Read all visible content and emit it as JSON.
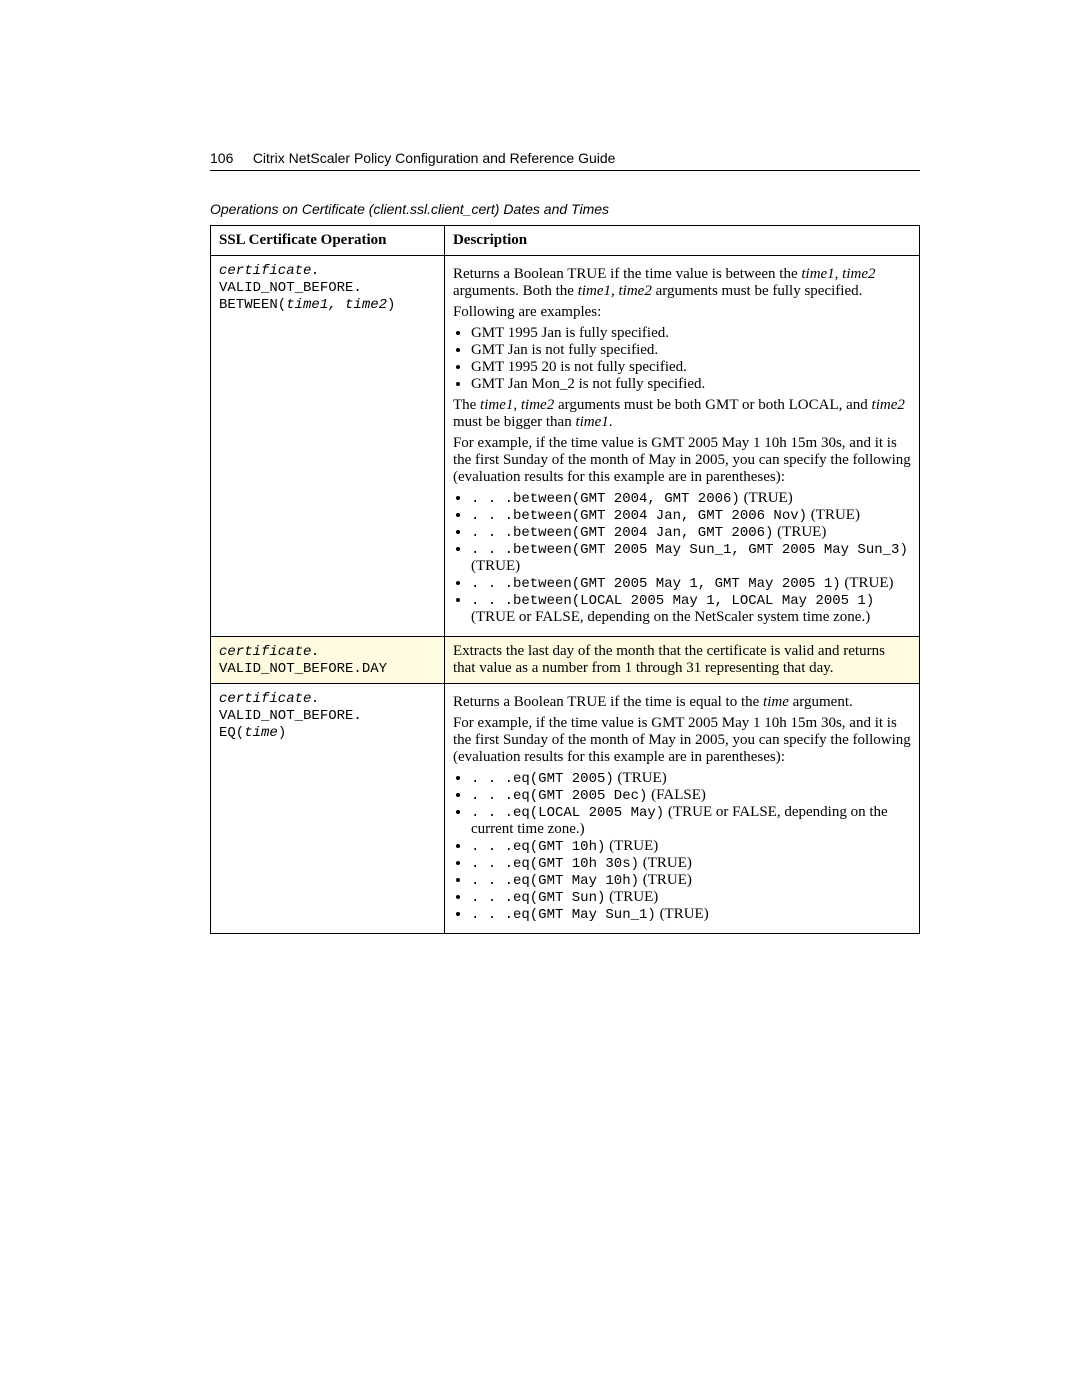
{
  "header": {
    "page_number": "106",
    "title": "Citrix NetScaler Policy Configuration and Reference Guide"
  },
  "caption": "Operations on Certificate (client.ssl.client_cert) Dates and Times",
  "table": {
    "headers": {
      "col1": "SSL Certificate Operation",
      "col2": "Description"
    },
    "rows": [
      {
        "op_prefix": "certificate.",
        "op_line2": "VALID_NOT_BEFORE.",
        "op_line3_a": "BETWEEN(",
        "op_line3_b": "time1, time2",
        "op_line3_c": ")",
        "desc": {
          "p1_a": "Returns a Boolean TRUE if the time value is between the ",
          "p1_i1": "time1, time2",
          "p1_b": " arguments. Both the ",
          "p1_i2": "time1, time2",
          "p1_c": " arguments must be fully specified.",
          "p2": "Following are examples:",
          "list1": [
            "GMT 1995 Jan is fully specified.",
            "GMT Jan is not fully specified.",
            "GMT 1995 20 is not fully specified.",
            "GMT Jan Mon_2 is not fully specified."
          ],
          "p3_a": "The ",
          "p3_i1": "time1, time2",
          "p3_b": " arguments must be both GMT or both LOCAL, and ",
          "p3_i2": "time2",
          "p3_c": " must be bigger than ",
          "p3_i3": "time1",
          "p3_d": ".",
          "p4": "For example, if the time value is GMT 2005 May 1 10h 15m 30s, and it is the first Sunday of the month of May in 2005, you can specify the following (evaluation results for this example are in parentheses):",
          "list2": [
            {
              "code": ". . .between(GMT 2004, GMT 2006)",
              "tail": " (TRUE)"
            },
            {
              "code": ". . .between(GMT 2004 Jan, GMT 2006 Nov)",
              "tail": " (TRUE)"
            },
            {
              "code": ". . .between(GMT 2004 Jan, GMT 2006)",
              "tail": " (TRUE)"
            },
            {
              "code": ". . .between(GMT 2005 May Sun_1, GMT 2005 May Sun_3)",
              "tail": " (TRUE)"
            },
            {
              "code": ". . .between(GMT 2005 May 1, GMT May 2005 1)",
              "tail": " (TRUE)"
            },
            {
              "code": ". . .between(LOCAL 2005 May 1, LOCAL May 2005 1)",
              "tail": " (TRUE or FALSE, depending on the NetScaler system time zone.)"
            }
          ]
        }
      },
      {
        "highlight": true,
        "op_prefix": "certificate.",
        "op_line2": "VALID_NOT_BEFORE.DAY",
        "desc_text": "Extracts the last day of the month that the certificate is valid and returns that value as a number from 1 through 31 representing that day."
      },
      {
        "op_prefix": "certificate.",
        "op_line2": "VALID_NOT_BEFORE.",
        "op_line3_a": "EQ(",
        "op_line3_b": "time",
        "op_line3_c": ")",
        "desc": {
          "p1_a": "Returns a Boolean TRUE if the time is equal to the ",
          "p1_i1": "time",
          "p1_b": " argument.",
          "p2": "For example, if the time value is GMT 2005 May 1 10h 15m 30s, and it is the first Sunday of the month of May in 2005, you can specify the following (evaluation results for this example are in parentheses):",
          "list": [
            {
              "code": ". . .eq(GMT 2005)",
              "tail": " (TRUE)"
            },
            {
              "code": ". . .eq(GMT 2005 Dec)",
              "tail": " (FALSE)"
            },
            {
              "code": ". . .eq(LOCAL 2005 May)",
              "tail": " (TRUE or FALSE, depending on the current time zone.)"
            },
            {
              "code": ". . .eq(GMT 10h)",
              "tail": " (TRUE)"
            },
            {
              "code": ". . .eq(GMT 10h 30s)",
              "tail": " (TRUE)"
            },
            {
              "code": ". . .eq(GMT May 10h)",
              "tail": " (TRUE)"
            },
            {
              "code": ". . .eq(GMT Sun)",
              "tail": " (TRUE)"
            },
            {
              "code": ". . .eq(GMT May Sun_1)",
              "tail": " (TRUE)"
            }
          ]
        }
      }
    ]
  }
}
